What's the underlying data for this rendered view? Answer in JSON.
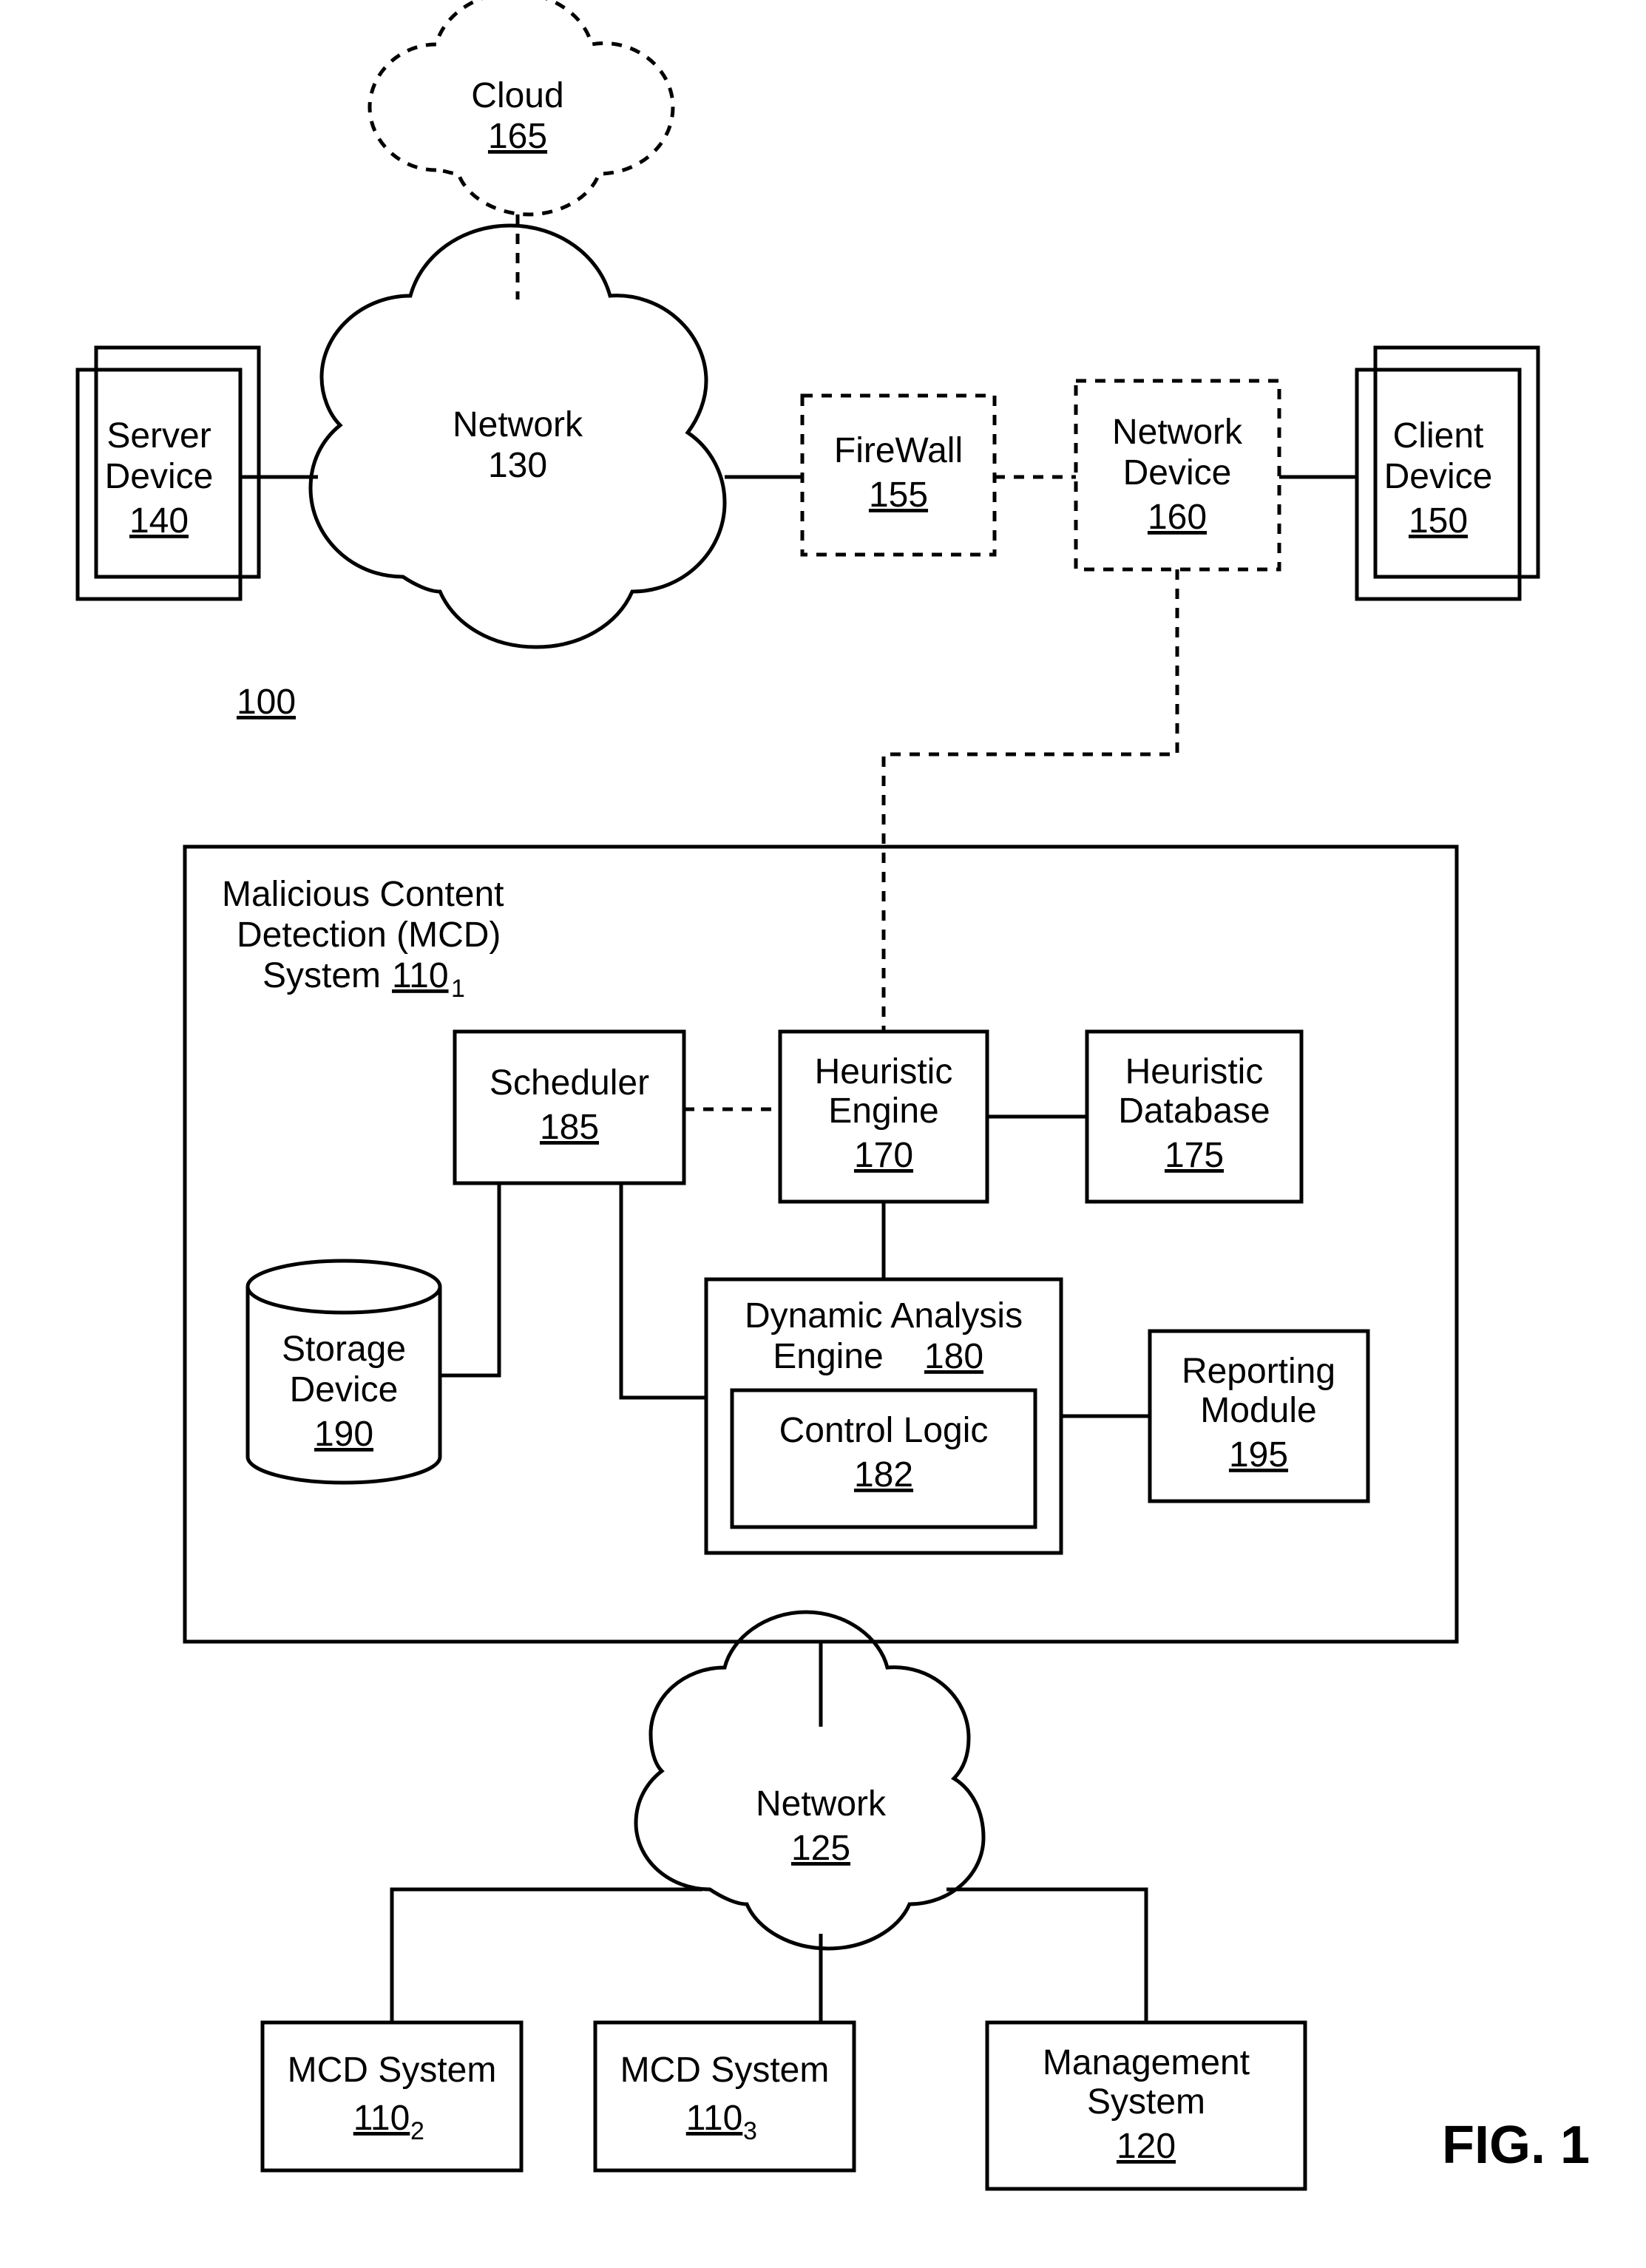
{
  "figure_label": "FIG. 1",
  "system_ref": "100",
  "nodes": {
    "cloud_top": {
      "label": "Cloud",
      "ref": "165"
    },
    "server_device": {
      "label1": "Server",
      "label2": "Device",
      "ref": "140"
    },
    "network_main": {
      "label": "Network",
      "ref": "130"
    },
    "firewall": {
      "label": "FireWall",
      "ref": "155"
    },
    "network_device": {
      "label1": "Network",
      "label2": "Device",
      "ref": "160"
    },
    "client_device": {
      "label1": "Client",
      "label2": "Device",
      "ref": "150"
    },
    "mcd": {
      "label1": "Malicious Content",
      "label2": "Detection (MCD)",
      "label3": "System ",
      "ref": "110",
      "sub": "1"
    },
    "scheduler": {
      "label": "Scheduler",
      "ref": "185"
    },
    "heur_engine": {
      "label1": "Heuristic",
      "label2": "Engine",
      "ref": "170"
    },
    "heur_db": {
      "label1": "Heuristic",
      "label2": "Database",
      "ref": "175"
    },
    "storage": {
      "label1": "Storage",
      "label2": "Device",
      "ref": "190"
    },
    "dyn": {
      "label1": "Dynamic Analysis",
      "label2": "Engine ",
      "ref": "180"
    },
    "control": {
      "label": "Control Logic",
      "ref": "182"
    },
    "reporting": {
      "label1": "Reporting",
      "label2": "Module",
      "ref": "195"
    },
    "network_bottom": {
      "label": "Network",
      "ref": "125"
    },
    "mcd2": {
      "label": "MCD System",
      "ref": "110",
      "sub": "2"
    },
    "mcd3": {
      "label": "MCD System",
      "ref": "110",
      "sub": "3"
    },
    "mgmt": {
      "label1": "Management",
      "label2": "System",
      "ref": "120"
    }
  }
}
